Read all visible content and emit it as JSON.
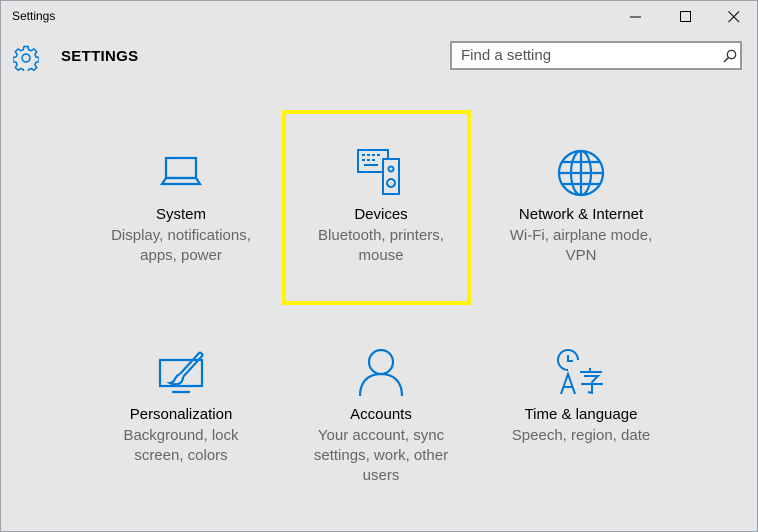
{
  "window": {
    "title": "Settings"
  },
  "header": {
    "title": "SETTINGS"
  },
  "search": {
    "placeholder": "Find a setting"
  },
  "colors": {
    "accent": "#0078d7",
    "highlight": "#fff500",
    "background": "#e6e6e6"
  },
  "tiles": [
    {
      "name": "System",
      "desc1": "Display, notifications,",
      "desc2": "apps, power",
      "icon": "laptop-icon"
    },
    {
      "name": "Devices",
      "desc1": "Bluetooth, printers,",
      "desc2": "mouse",
      "icon": "devices-icon"
    },
    {
      "name": "Network & Internet",
      "desc1": "Wi-Fi, airplane mode,",
      "desc2": "VPN",
      "icon": "globe-icon"
    },
    {
      "name": "Personalization",
      "desc1": "Background, lock",
      "desc2": "screen, colors",
      "icon": "paint-icon"
    },
    {
      "name": "Accounts",
      "desc1": "Your account, sync",
      "desc2": "settings, work, other",
      "desc3": "users",
      "icon": "person-icon"
    },
    {
      "name": "Time & language",
      "desc1": "Speech, region, date",
      "icon": "clock-language-icon"
    }
  ]
}
